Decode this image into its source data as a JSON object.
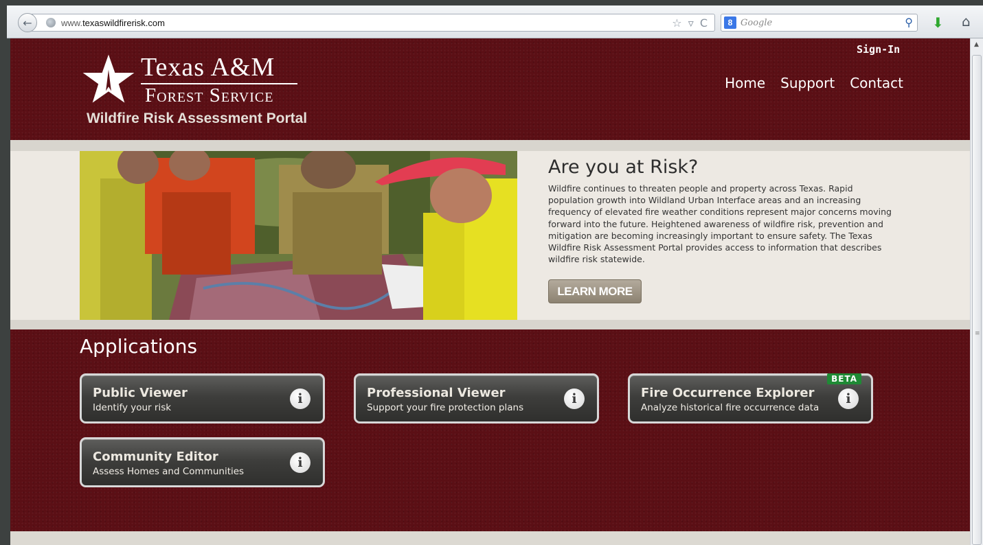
{
  "browser": {
    "url_plain": "www.",
    "url_domain": "texaswildfirerisk.com",
    "search_placeholder": "Google",
    "search_engine_badge": "8",
    "url_icons": "☆ ▿ C"
  },
  "header": {
    "brand_line1": "Texas A&M",
    "brand_line2": "Forest Service",
    "portal_title": "Wildfire Risk Assessment Portal",
    "signin": "Sign-In",
    "nav": [
      "Home",
      "Support",
      "Contact"
    ]
  },
  "hero": {
    "heading": "Are you at Risk?",
    "body": "Wildfire continues to threaten people and property across Texas. Rapid population growth into Wildland Urban Interface areas and an increasing frequency of elevated fire weather conditions represent major concerns moving forward into the future. Heightened awareness of wildfire risk, prevention and mitigation are becoming increasingly important to ensure safety. The Texas Wildfire Risk Assessment Portal provides access to information that describes wildfire risk statewide.",
    "learn_more": "LEARN MORE"
  },
  "applications": {
    "heading": "Applications",
    "items": [
      {
        "title": "Public Viewer",
        "subtitle": "Identify your risk",
        "badge": ""
      },
      {
        "title": "Professional Viewer",
        "subtitle": "Support your fire protection plans",
        "badge": ""
      },
      {
        "title": "Fire Occurrence Explorer",
        "subtitle": "Analyze historical fire occurrence data",
        "badge": "BETA"
      },
      {
        "title": "Community Editor",
        "subtitle": "Assess Homes and Communities",
        "badge": ""
      }
    ],
    "info_glyph": "i"
  },
  "colors": {
    "maroon": "#5b0f15",
    "beta_green": "#1f8a35",
    "button_tan": "#a89e8e"
  }
}
